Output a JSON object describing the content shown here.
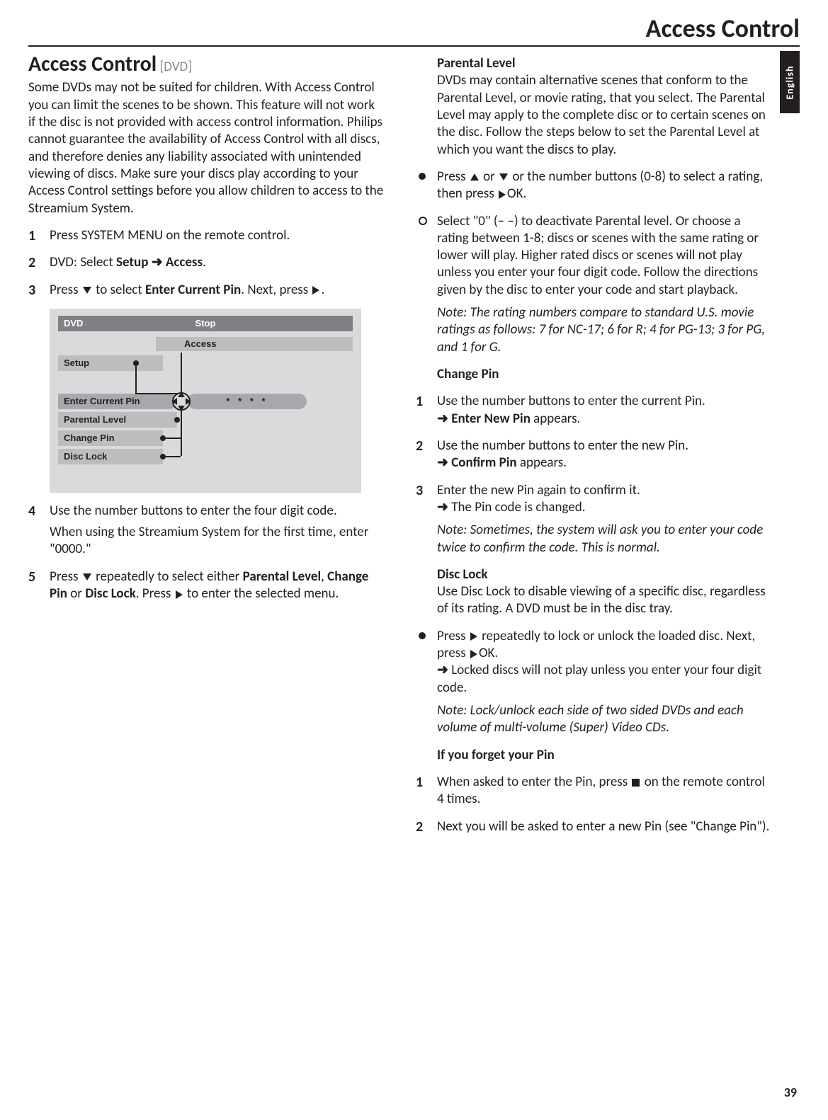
{
  "header": {
    "title": "Access Control"
  },
  "lang_tab": "English",
  "page_number": "39",
  "left": {
    "title": "Access Control",
    "tag": "[DVD]",
    "intro": "Some DVDs may not be suited for children. With Access Control you can limit the scenes to be shown. This feature will not work if the disc is not provided with access control information. Philips cannot guarantee the availability of Access Control with all discs, and therefore denies any liability associated with unintended viewing of discs. Make sure your discs play according to your Access Control settings before you allow children to access to the Streamium System.",
    "step1": "Press SYSTEM MENU on the remote control.",
    "step2_a": "DVD: Select ",
    "step2_b": "Setup ",
    "step2_c": " Access",
    "step3_a": "Press ",
    "step3_b": " to select ",
    "step3_c": "Enter Current Pin",
    "step3_d": ". Next, press ",
    "step4_a": "Use the number buttons to enter the four digit code.",
    "step4_b": "When using the Streamium System for the first time, enter \"0000.\"",
    "step5_a": "Press ",
    "step5_b": " repeatedly to select either ",
    "step5_c": "Parental Level",
    "step5_d": "Change Pin",
    "step5_e": " or ",
    "step5_f": "Disc Lock",
    "step5_g": ". Press ",
    "step5_h": " to enter the selected menu."
  },
  "osd": {
    "dvd": "DVD",
    "stop": "Stop",
    "access": "Access",
    "setup": "Setup",
    "enter_pin": "Enter Current Pin",
    "pin_mask": "* * * *",
    "parental": "Parental Level",
    "change_pin": "Change Pin",
    "disc_lock": "Disc Lock"
  },
  "right": {
    "pl_h": "Parental Level",
    "pl_p": "DVDs may contain alternative scenes that conform to the Parental Level, or movie rating, that you select. The Parental Level may apply to the complete disc or to certain scenes on the disc. Follow the steps below to set the Parental Level at which you want the discs to play.",
    "pl_b1_a": "Press ",
    "pl_b1_b": " or ",
    "pl_b1_c": " or the number buttons (0-8) to select a rating, then press ",
    "pl_b1_d": "OK.",
    "pl_b2": "Select \"0\" (– –) to deactivate Parental level. Or choose a rating between 1-8; discs or scenes with the same rating or lower will play. Higher rated discs or scenes will not play unless you enter your four digit code. Follow the directions given by the disc to enter your code and start playback.",
    "pl_note": "Note: The rating numbers compare to standard U.S. movie ratings as follows: 7 for NC-17; 6 for R; 4 for PG-13; 3 for PG, and 1 for G.",
    "cp_h": "Change Pin",
    "cp1_a": "Use the number buttons to enter the current Pin.",
    "cp1_b": "Enter New Pin",
    "cp1_c": " appears.",
    "cp2_a": "Use the number buttons to enter the new Pin.",
    "cp2_b": "Confirm Pin",
    "cp2_c": " appears.",
    "cp3_a": "Enter the new Pin again to confirm it.",
    "cp3_b": " The Pin code is changed.",
    "cp_note": "Note: Sometimes, the system will ask you to enter your code twice to confirm the code. This is normal.",
    "dl_h": "Disc Lock",
    "dl_p": "Use Disc Lock to disable viewing of a specific disc, regardless of its rating. A DVD must be in the disc tray.",
    "dl_b_a": "Press ",
    "dl_b_b": " repeatedly to lock or unlock the loaded disc. Next, press ",
    "dl_b_c": "OK.",
    "dl_b_d": " Locked discs will not play unless you enter your four digit code.",
    "dl_note": "Note: Lock/unlock each side of two sided DVDs and each volume of multi-volume (Super) Video CDs.",
    "fp_h": "If you forget your Pin",
    "fp1_a": "When asked to enter the Pin, press ",
    "fp1_b": " on the remote control 4 times.",
    "fp2": "Next you will be asked to enter a new Pin (see \"Change Pin\")."
  }
}
